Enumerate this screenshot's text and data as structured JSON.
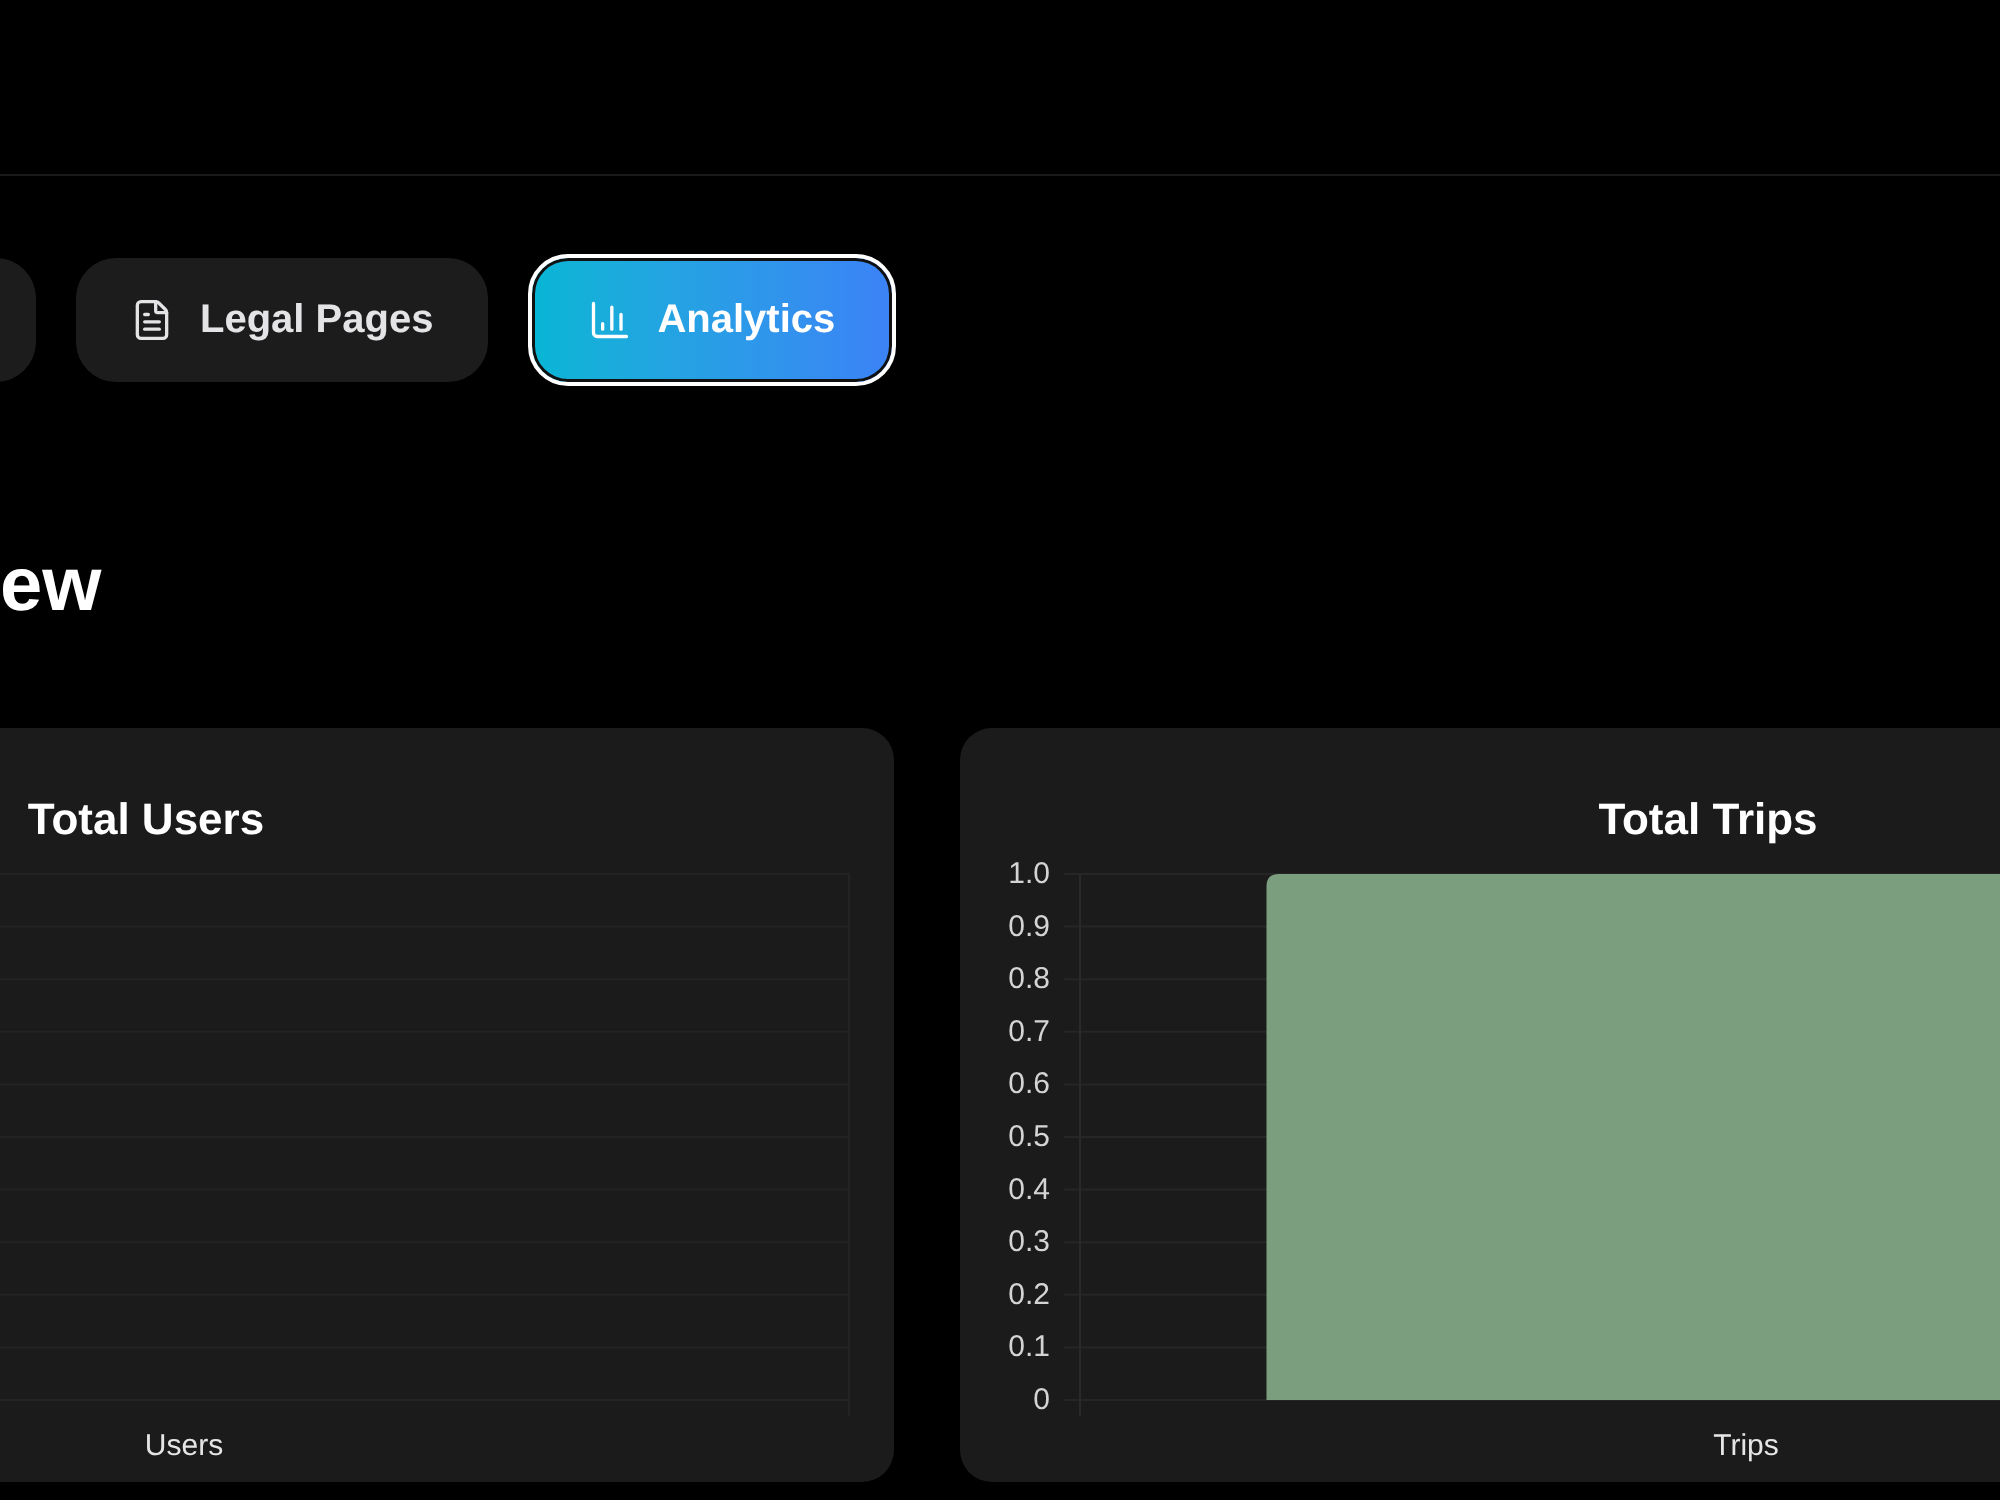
{
  "tabs": [
    {
      "selected": false
    },
    {
      "label": "Legal Pages",
      "selected": false
    },
    {
      "label": "Analytics",
      "selected": true
    }
  ],
  "heading": "ew",
  "cards": [
    {
      "kind": "plain",
      "title": "Total Users",
      "axis_label": "Users"
    },
    {
      "kind": "bar",
      "title": "Total Trips",
      "chart_data": {
        "type": "bar",
        "grid": true,
        "categories": [
          "Trips"
        ],
        "series": [
          {
            "color": "#7a9e7e",
            "values": [
              1
            ]
          }
        ],
        "ylim": [
          0,
          1
        ],
        "yticks": [
          0,
          0.1,
          0.2,
          0.3,
          0.4,
          0.5,
          0.6,
          0.7,
          0.8,
          0.9,
          {
            "value": 1,
            "label": "1.0"
          }
        ]
      }
    }
  ]
}
